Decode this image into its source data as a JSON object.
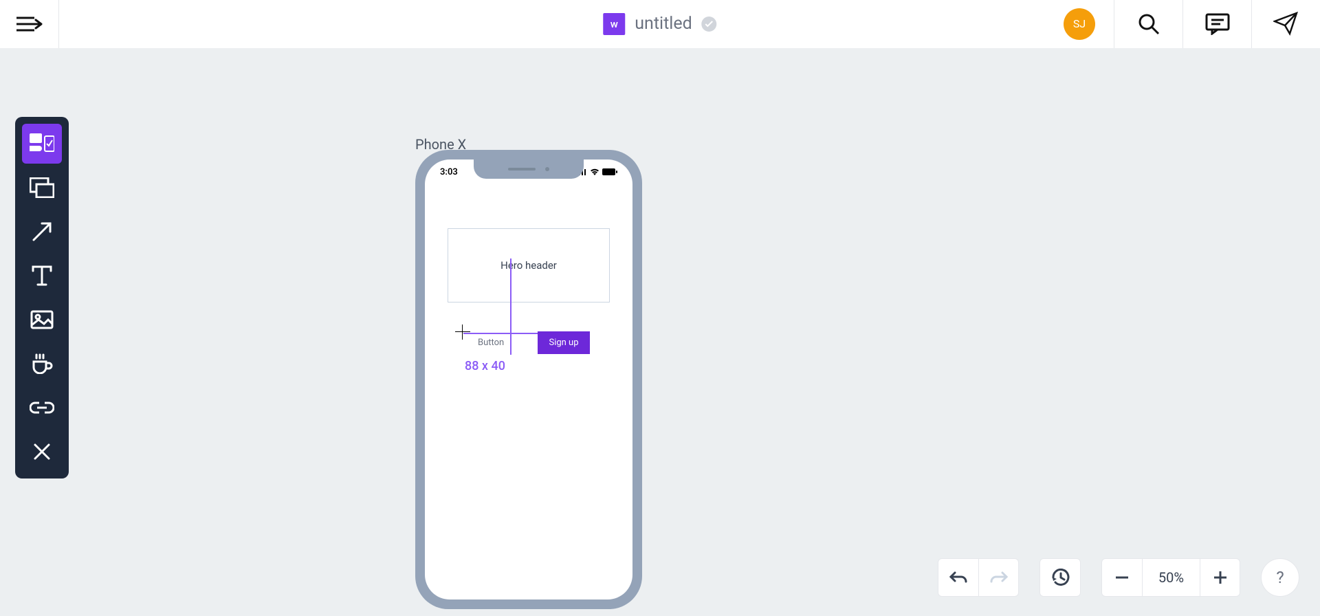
{
  "header": {
    "doc_badge": "w",
    "doc_title": "untitled",
    "avatar": "SJ"
  },
  "toolbar": {
    "tools": [
      "components",
      "frame",
      "arrow",
      "text",
      "image",
      "coffee",
      "link",
      "close"
    ]
  },
  "artboard": {
    "label": "Phone X",
    "statusbar_time": "3:03",
    "hero_label": "Hero header",
    "signup_label": "Sign up",
    "drag_label": "Button",
    "size_label": "88 x 40"
  },
  "footer": {
    "zoom": "50%",
    "help": "?"
  }
}
